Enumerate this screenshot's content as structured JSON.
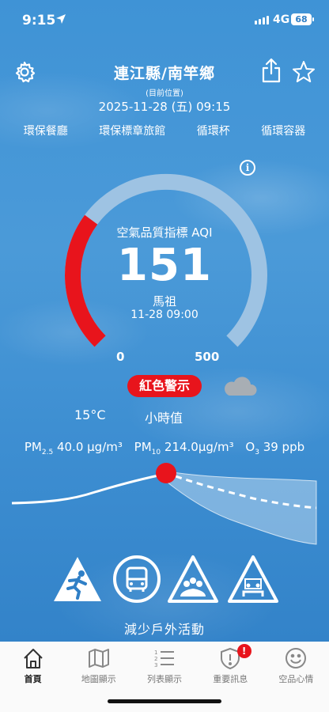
{
  "status_bar": {
    "time": "9:15",
    "network": "4G",
    "battery": "68"
  },
  "header": {
    "title": "連江縣/南竿鄉",
    "subtitle": "(目前位置)",
    "datetime": "2025-11-28 (五) 09:15"
  },
  "links": [
    "環保餐廳",
    "環保標章旅館",
    "循環杯",
    "循環容器"
  ],
  "gauge": {
    "label": "空氣品質指標 AQI",
    "value": "151",
    "aqi_value": 151,
    "min": "0",
    "max": "500",
    "station": "馬祖",
    "station_time": "11-28 09:00",
    "level_color": "#e8141c",
    "track_color": "#9ec3e3"
  },
  "alert": {
    "label": "紅色警示",
    "weather_icon": "cloud-icon"
  },
  "conditions": {
    "temperature": "15°C",
    "type": "小時值"
  },
  "pollutants": {
    "pm25_label": "PM",
    "pm25_sub": "2.5",
    "pm25_value": "40.0 μg/m³",
    "pm10_label": "PM",
    "pm10_sub": "10",
    "pm10_value": "214.0μg/m³",
    "o3_label": "O",
    "o3_sub": "3",
    "o3_value": "39 ppb"
  },
  "signs": [
    "running-person-warning-icon",
    "bus-icon",
    "people-group-warning-icon",
    "classroom-warning-icon"
  ],
  "advice": "減少戶外活動",
  "tabs": [
    {
      "label": "首頁",
      "icon": "home-icon",
      "active": true
    },
    {
      "label": "地圖顯示",
      "icon": "map-icon",
      "active": false
    },
    {
      "label": "列表顯示",
      "icon": "list-icon",
      "active": false
    },
    {
      "label": "重要訊息",
      "icon": "alert-shield-icon",
      "badge": "!",
      "active": false
    },
    {
      "label": "空品心情",
      "icon": "smiley-icon",
      "active": false
    }
  ]
}
